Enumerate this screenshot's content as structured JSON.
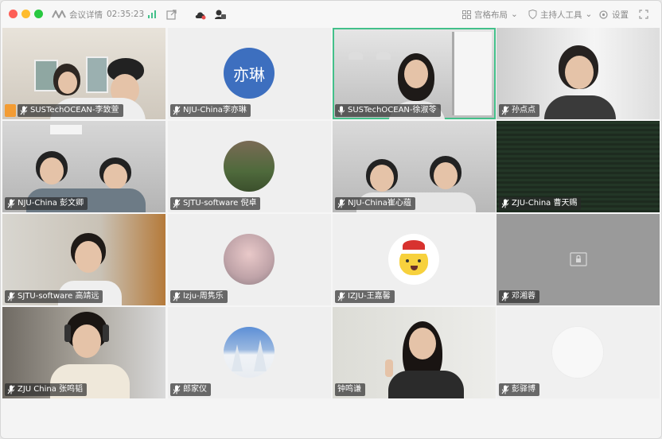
{
  "titlebar": {
    "meeting_info_label": "会议详情",
    "timer": "02:35:23",
    "layout_label": "宫格布局",
    "host_tools_label": "主持人工具",
    "settings_label": "设置"
  },
  "participants": [
    {
      "name": "SUSTechOCEAN-李致萱",
      "kind": "video"
    },
    {
      "name": "NJU-China李亦琳",
      "kind": "avatar",
      "avatar_text": "亦琳",
      "avatar_color": "#3d6fbf"
    },
    {
      "name": "SUSTechOCEAN-徐淑苓",
      "kind": "video"
    },
    {
      "name": "孙点点",
      "kind": "video"
    },
    {
      "name": "NJU-China 彭文卿",
      "kind": "video"
    },
    {
      "name": "SJTU-software 倪卓",
      "kind": "avatar"
    },
    {
      "name": "NJU-China崔心蕴",
      "kind": "video"
    },
    {
      "name": "ZJU-China 曹天赐",
      "kind": "video"
    },
    {
      "name": "SJTU-software 高靖远",
      "kind": "video"
    },
    {
      "name": "lzju-周隽乐",
      "kind": "avatar"
    },
    {
      "name": "IZJU-王嘉馨",
      "kind": "avatar"
    },
    {
      "name": "邓湘蓉",
      "kind": "video-off"
    },
    {
      "name": "ZJU China 张鸣韬",
      "kind": "video"
    },
    {
      "name": "郎家仪",
      "kind": "avatar"
    },
    {
      "name": "钟鸣谦",
      "kind": "video"
    },
    {
      "name": "彭驿博",
      "kind": "avatar"
    }
  ],
  "colors": {
    "active_speaker_border": "#43c08a",
    "name_tag_bg": "#282828"
  }
}
